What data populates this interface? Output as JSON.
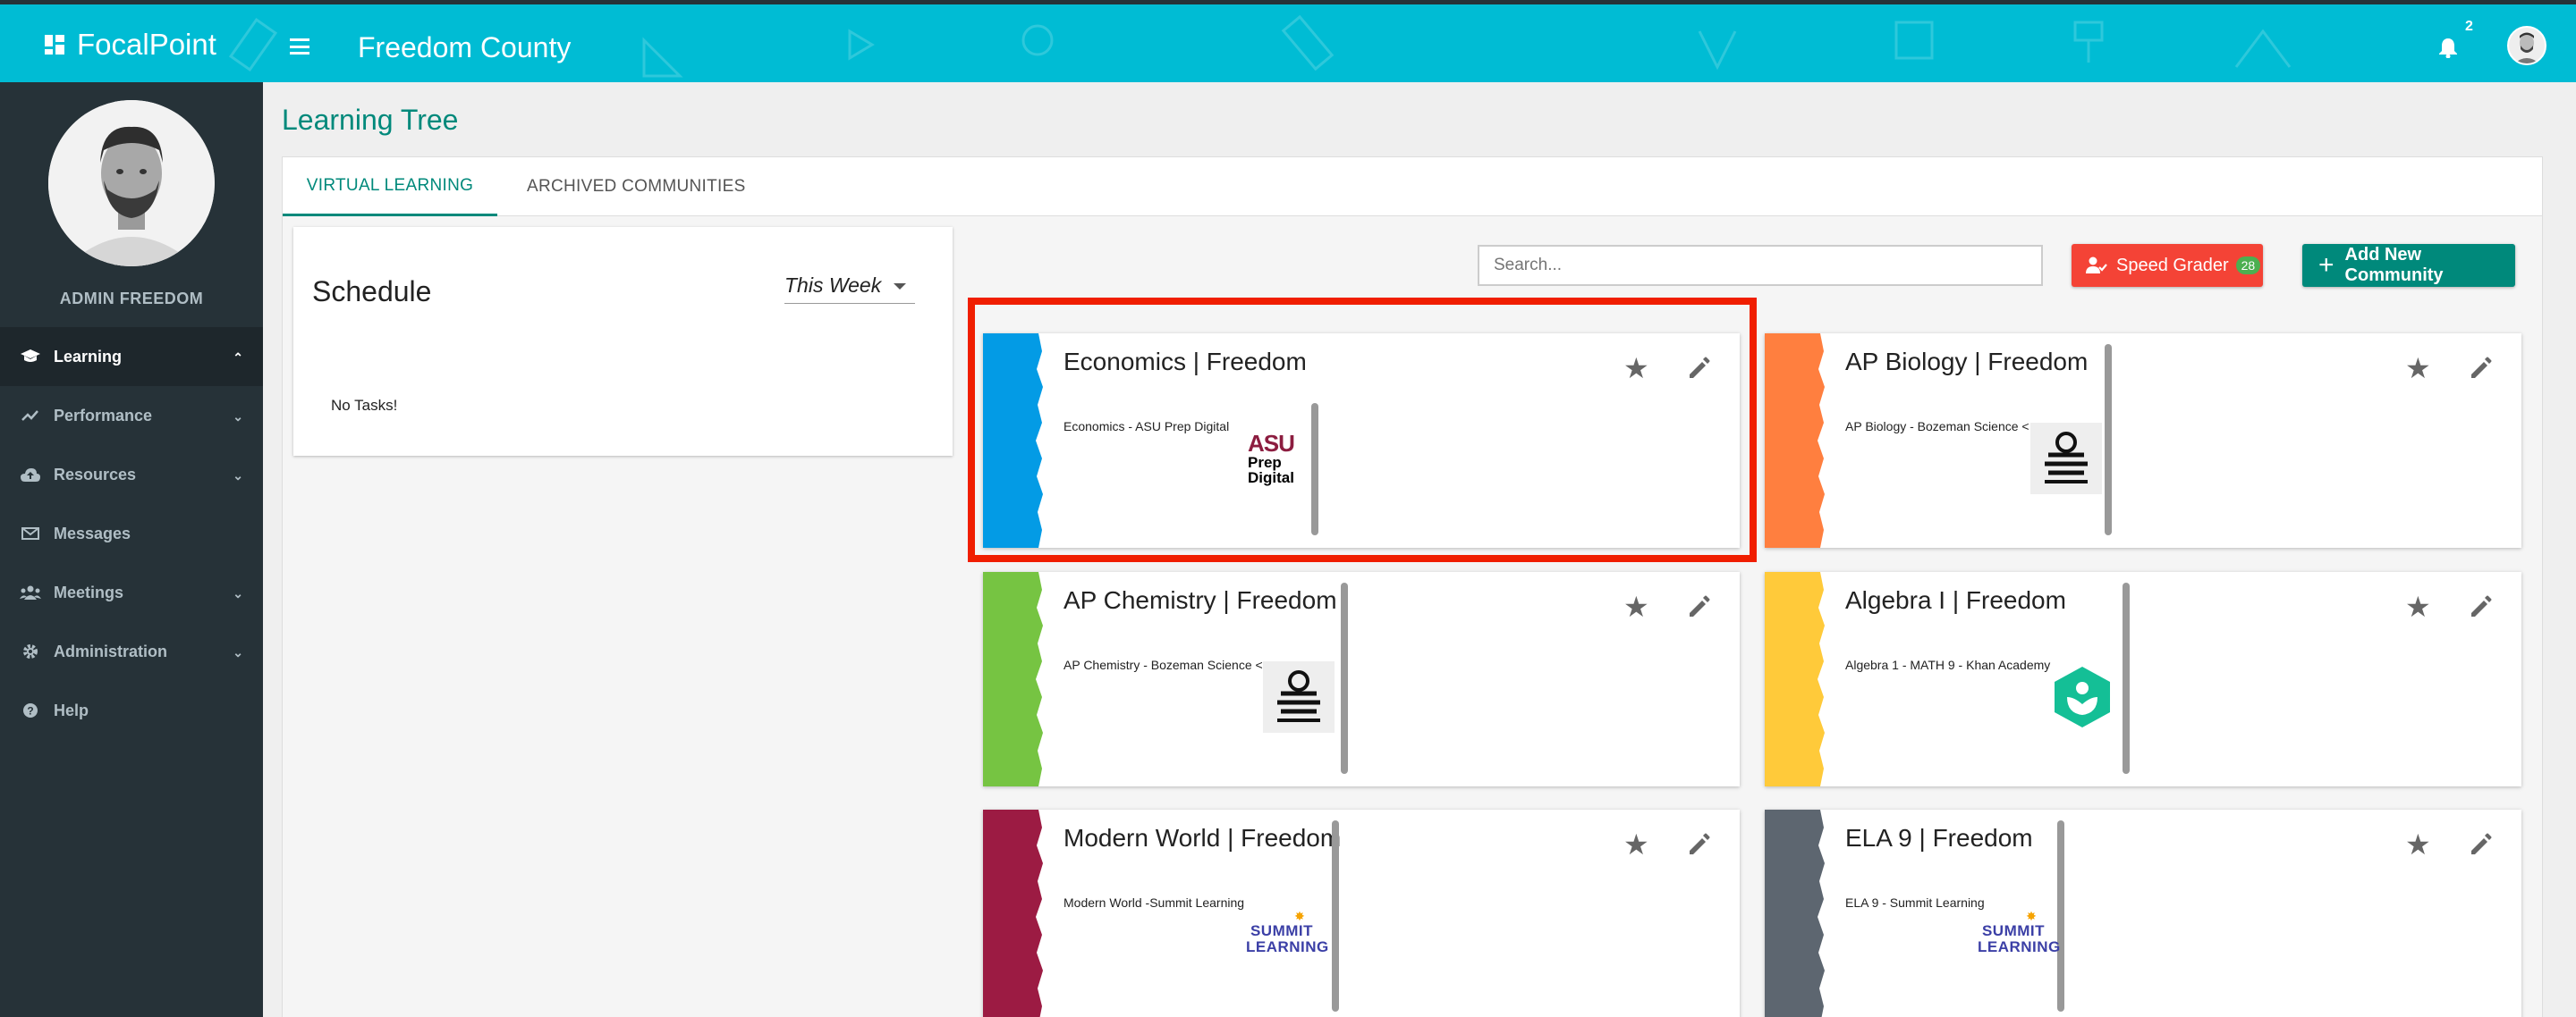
{
  "app": {
    "brand": "FocalPoint",
    "county": "Freedom County",
    "notification_count": "2"
  },
  "sidebar": {
    "admin_name": "ADMIN FREEDOM",
    "items": [
      {
        "label": "Learning",
        "icon": "graduation-cap-icon",
        "active": true
      },
      {
        "label": "Performance",
        "icon": "trending-up-icon"
      },
      {
        "label": "Resources",
        "icon": "cloud-upload-icon"
      },
      {
        "label": "Messages",
        "icon": "mail-icon"
      },
      {
        "label": "Meetings",
        "icon": "users-icon"
      },
      {
        "label": "Administration",
        "icon": "gear-icon"
      },
      {
        "label": "Help",
        "icon": "help-icon"
      }
    ]
  },
  "main": {
    "page_title": "Learning Tree",
    "tabs": [
      {
        "label": "VIRTUAL LEARNING"
      },
      {
        "label": "ARCHIVED COMMUNITIES"
      }
    ],
    "schedule": {
      "title": "Schedule",
      "range": "This Week",
      "empty": "No Tasks!"
    },
    "search": {
      "placeholder": "Search..."
    },
    "speed_grader": {
      "label": "Speed Grader",
      "count": "28"
    },
    "add_community": {
      "label": "Add New Community"
    }
  },
  "cards": [
    {
      "title": "Economics | Freedom",
      "subtitle": "Economics - ASU Prep Digital",
      "color": "#039be5",
      "logo_text": [
        "ASU",
        "Prep",
        "Digital"
      ]
    },
    {
      "title": "AP Biology | Freedom",
      "subtitle": "AP Biology - Bozeman Science  <",
      "color": "#ff7f3f",
      "logo_text": []
    },
    {
      "title": "AP Chemistry | Freedom",
      "subtitle": "AP Chemistry - Bozeman Science  <",
      "color": "#76c442",
      "logo_text": []
    },
    {
      "title": "Algebra I | Freedom",
      "subtitle": "Algebra 1 - MATH 9 - Khan Academy",
      "color": "#ffca3a",
      "logo_text": []
    },
    {
      "title": "Modern World | Freedom",
      "subtitle": "Modern World -Summit Learning",
      "color": "#9c1b43",
      "logo_text": [
        "SUMMIT",
        "LEARNING"
      ]
    },
    {
      "title": "ELA 9 | Freedom",
      "subtitle": "ELA 9 - Summit Learning",
      "color": "#5d6670",
      "logo_text": [
        "SUMMIT",
        "LEARNING"
      ]
    }
  ]
}
